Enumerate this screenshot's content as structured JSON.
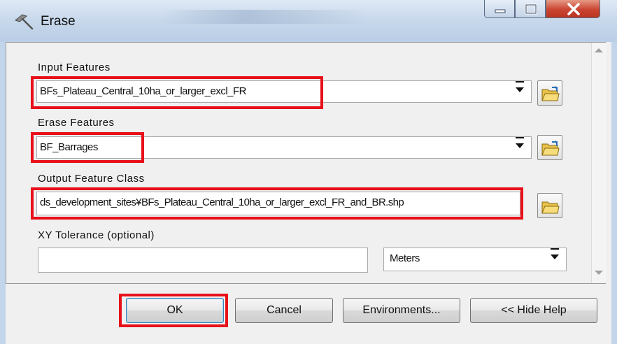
{
  "window": {
    "title": "Erase"
  },
  "form": {
    "input_features_label": "Input Features",
    "input_features_value": "BFs_Plateau_Central_10ha_or_larger_excl_FR",
    "erase_features_label": "Erase Features",
    "erase_features_value": "BF_Barrages",
    "output_feature_class_label": "Output Feature Class",
    "output_feature_class_value": "ds_development_sites¥BFs_Plateau_Central_10ha_or_larger_excl_FR_and_BR.shp",
    "xy_tolerance_label": "XY Tolerance (optional)",
    "xy_tolerance_value": "",
    "xy_tolerance_unit": "Meters"
  },
  "buttons": {
    "ok": "OK",
    "cancel": "Cancel",
    "environments": "Environments...",
    "hide_help": "<< Hide Help"
  },
  "colors": {
    "highlight": "#e8101a",
    "close_button": "#c94431",
    "title_bar": "#c9d9ec"
  },
  "icons": {
    "app": "erase-tool-icon",
    "browse": "folder-open-icon",
    "minimize": "minimize-icon",
    "maximize": "maximize-icon",
    "close": "close-icon"
  }
}
